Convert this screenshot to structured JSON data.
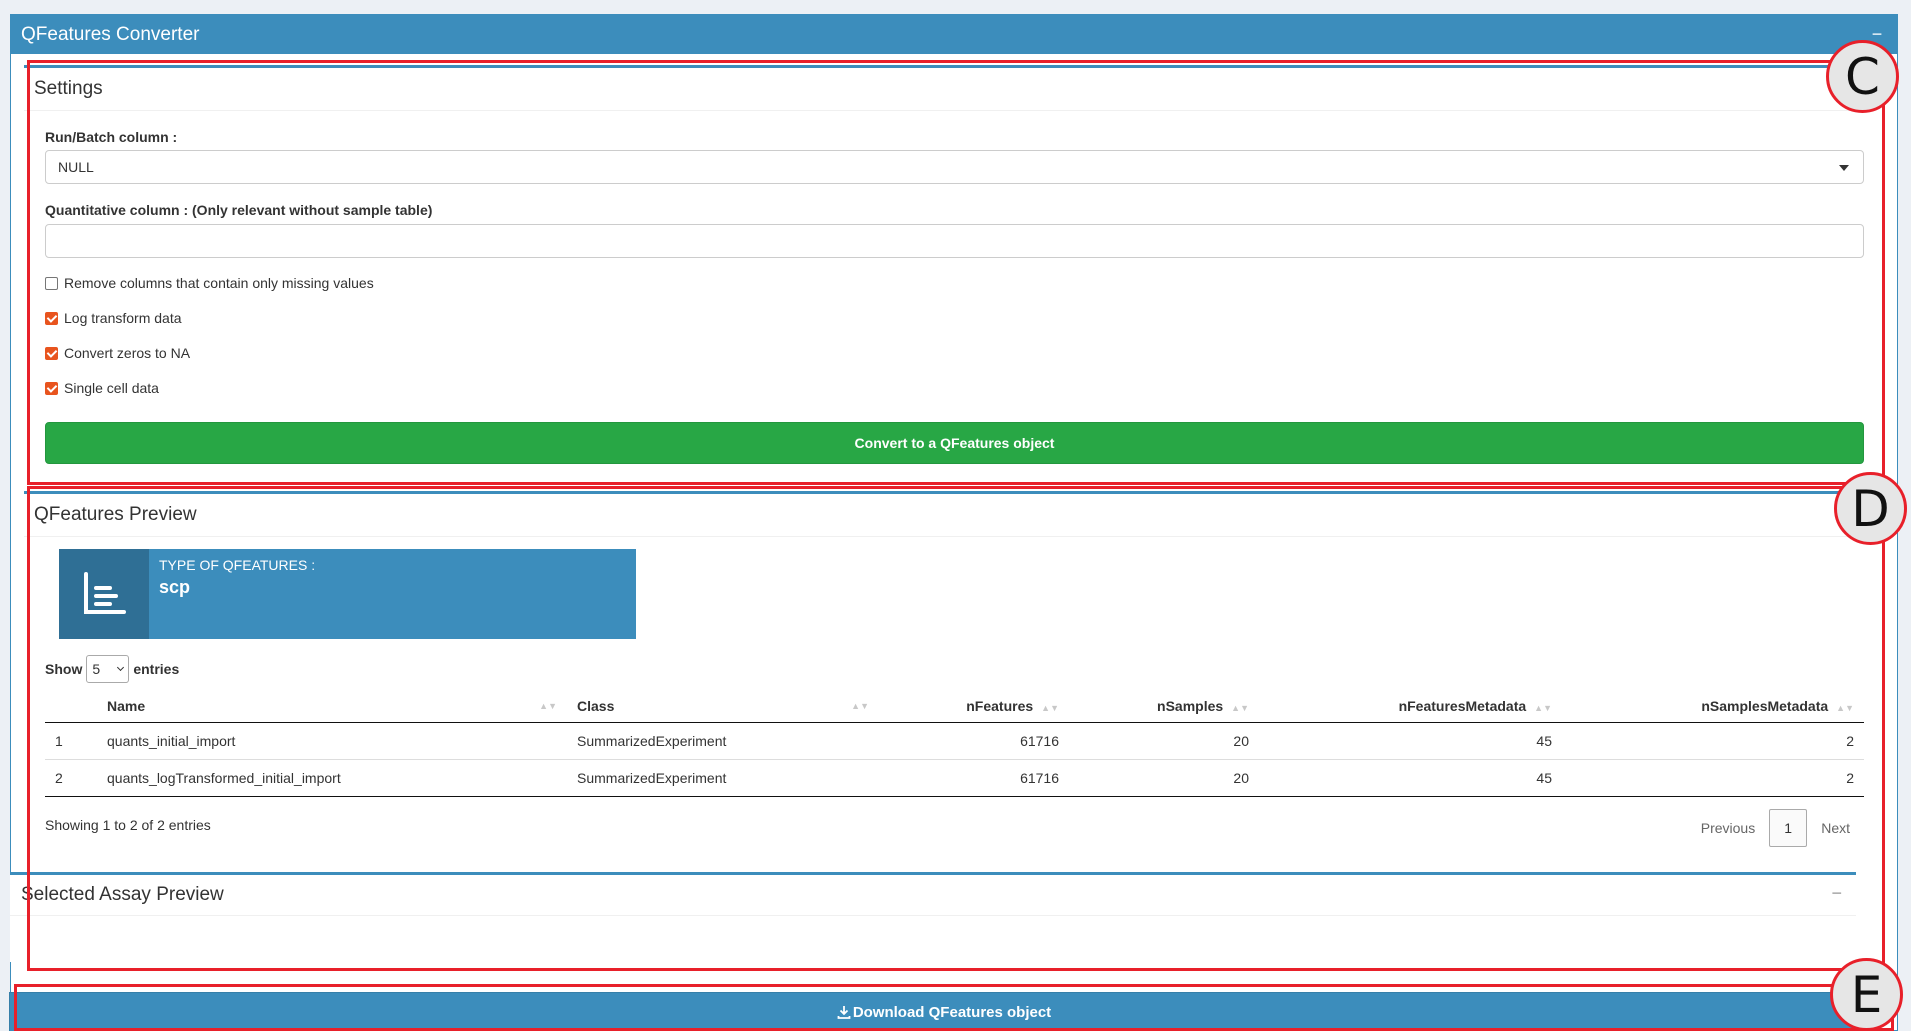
{
  "panel": {
    "title": "QFeatures Converter",
    "collapse_icon": "minus-icon"
  },
  "settings": {
    "title": "Settings",
    "run_batch_label": "Run/Batch column :",
    "run_batch_value": "NULL",
    "quant_label": "Quantitative column : (Only relevant without sample table)",
    "quant_value": "",
    "checkboxes": [
      {
        "label": "Remove columns that contain only missing values",
        "checked": false
      },
      {
        "label": "Log transform data",
        "checked": true
      },
      {
        "label": "Convert zeros to NA",
        "checked": true
      },
      {
        "label": "Single cell data",
        "checked": true
      }
    ],
    "convert_button": "Convert to a QFeatures object"
  },
  "preview": {
    "title": "QFeatures Preview",
    "info_label": "TYPE OF QFEATURES :",
    "info_value": "scp",
    "info_icon": "list-chart-icon",
    "show_label": "Show",
    "page_size": "5",
    "entries_label": "entries",
    "columns": [
      "",
      "Name",
      "Class",
      "nFeatures",
      "nSamples",
      "nFeaturesMetadata",
      "nSamplesMetadata"
    ],
    "rows": [
      [
        "1",
        "quants_initial_import",
        "SummarizedExperiment",
        "61716",
        "20",
        "45",
        "2"
      ],
      [
        "2",
        "quants_logTransformed_initial_import",
        "SummarizedExperiment",
        "61716",
        "20",
        "45",
        "2"
      ]
    ],
    "info_text": "Showing 1 to 2 of 2 entries",
    "prev_label": "Previous",
    "page": "1",
    "next_label": "Next"
  },
  "assay": {
    "title": "Selected Assay Preview",
    "collapse_icon": "minus-icon"
  },
  "download": {
    "label": "Download QFeatures object",
    "icon": "download-icon"
  },
  "callouts": [
    "C",
    "D",
    "E"
  ],
  "colors": {
    "primary": "#3c8dbc",
    "success": "#28a745",
    "checkbox": "#e8541e",
    "annotation": "#e8202a"
  }
}
